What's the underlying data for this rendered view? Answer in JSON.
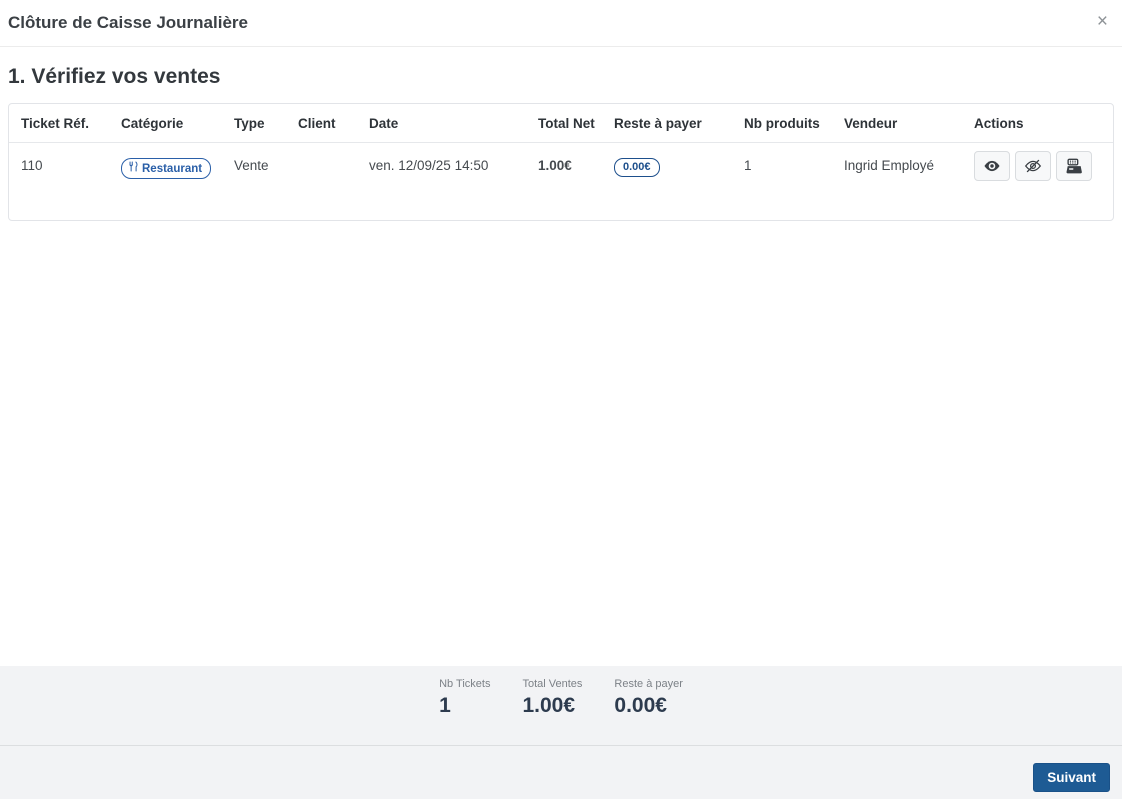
{
  "modal": {
    "title": "Clôture de Caisse Journalière",
    "close_label": "×"
  },
  "step": {
    "heading": "1. Vérifiez vos ventes"
  },
  "sales_table": {
    "headers": [
      "Ticket Réf.",
      "Catégorie",
      "Type",
      "Client",
      "Date",
      "Total Net",
      "Reste à payer",
      "Nb produits",
      "Vendeur",
      "Actions"
    ],
    "row": {
      "ticket_ref": "110",
      "category": "Restaurant",
      "type": "Vente",
      "client": "",
      "date": "ven. 12/09/25 14:50",
      "total_net": "1.00€",
      "reste_a_payer": "0.00€",
      "nb_produits": "1",
      "vendeur": "Ingrid Employé",
      "action_icons": [
        "eye-icon",
        "eye-slash-icon",
        "cash-register-icon"
      ]
    }
  },
  "summary": {
    "stats": [
      {
        "label": "Nb Tickets",
        "value": "1"
      },
      {
        "label": "Total Ventes",
        "value": "1.00€"
      },
      {
        "label": "Reste à payer",
        "value": "0.00€"
      }
    ]
  },
  "footer": {
    "next_label": "Suivant"
  },
  "colors": {
    "accent_blue": "#1e5b94",
    "badge_category_blue": "#2a5fa8",
    "badge_amount_blue": "#1d4f8c",
    "summary_value": "#2d3b4e",
    "band_gray": "#f2f3f5"
  }
}
